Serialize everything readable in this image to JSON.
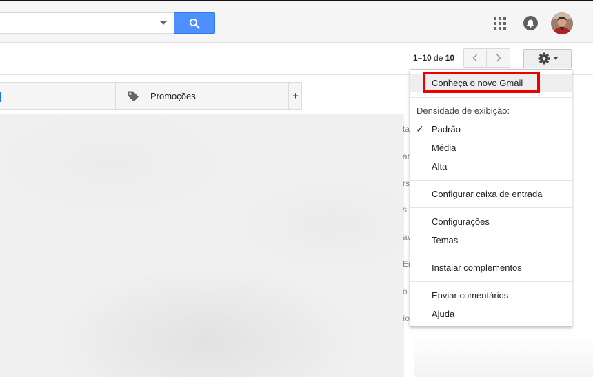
{
  "header": {
    "search_placeholder": ""
  },
  "toolbar": {
    "pager_range": "1–10",
    "pager_of": "de",
    "pager_total": "10"
  },
  "tabs": {
    "promos_label": "Promoções",
    "add_label": "+"
  },
  "inbox_peek": [
    "ta",
    "ar",
    "rs",
    "s V",
    "av",
    "Er",
    "o r",
    "ío"
  ],
  "settings_menu": {
    "new_gmail": "Conheça o novo Gmail",
    "density_heading": "Densidade de exibição:",
    "density_check": "✓",
    "density_options": [
      "Padrão",
      "Média",
      "Alta"
    ],
    "configure_inbox": "Configurar caixa de entrada",
    "settings": "Configurações",
    "themes": "Temas",
    "install_addons": "Instalar complementos",
    "send_feedback": "Enviar comentários",
    "help": "Ajuda"
  },
  "colors": {
    "search_button": "#4d90fe",
    "highlight_box": "#ee0000",
    "primary_tab_accent": "#1a73e8"
  }
}
